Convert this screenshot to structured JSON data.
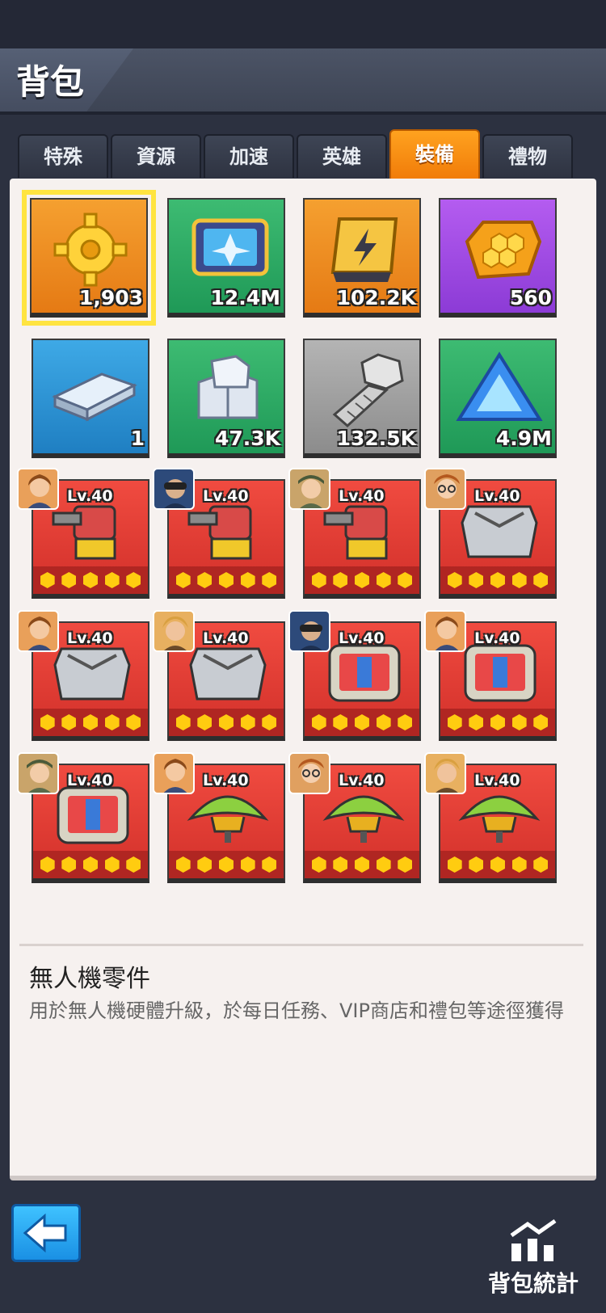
{
  "header": {
    "title": "背包"
  },
  "tabs": [
    {
      "label": "特殊",
      "active": false
    },
    {
      "label": "資源",
      "active": false
    },
    {
      "label": "加速",
      "active": false
    },
    {
      "label": "英雄",
      "active": false
    },
    {
      "label": "裝備",
      "active": true
    },
    {
      "label": "禮物",
      "active": false
    }
  ],
  "items": [
    {
      "icon": "gear-icon",
      "count": "1,903",
      "bg": "orange",
      "selected": true
    },
    {
      "icon": "drone-chip-icon",
      "count": "12.4M",
      "bg": "green"
    },
    {
      "icon": "energy-module-icon",
      "count": "102.2K",
      "bg": "orange"
    },
    {
      "icon": "honeycomb-armor-icon",
      "count": "560",
      "bg": "purple"
    },
    {
      "icon": "steel-ingot-icon",
      "count": "1",
      "bg": "blue"
    },
    {
      "icon": "alloy-blocks-icon",
      "count": "47.3K",
      "bg": "green"
    },
    {
      "icon": "bolt-icon",
      "count": "132.5K",
      "bg": "gray"
    },
    {
      "icon": "crystal-triangle-icon",
      "count": "4.9M",
      "bg": "green"
    }
  ],
  "equipment": [
    {
      "icon": "turret-icon",
      "level": "Lv.40",
      "hero": "hero-portrait-icon",
      "stars": 5
    },
    {
      "icon": "turret-icon",
      "level": "Lv.40",
      "hero": "hero-portrait-icon",
      "stars": 5
    },
    {
      "icon": "turret-icon",
      "level": "Lv.40",
      "hero": "hero-portrait-icon",
      "stars": 5
    },
    {
      "icon": "armor-plate-icon",
      "level": "Lv.40",
      "hero": "hero-portrait-icon",
      "stars": 5
    },
    {
      "icon": "armor-plate-icon",
      "level": "Lv.40",
      "hero": "hero-portrait-icon",
      "stars": 5
    },
    {
      "icon": "armor-plate-icon",
      "level": "Lv.40",
      "hero": "hero-portrait-icon",
      "stars": 5
    },
    {
      "icon": "radar-screen-icon",
      "level": "Lv.40",
      "hero": "hero-portrait-icon",
      "stars": 5
    },
    {
      "icon": "radar-screen-icon",
      "level": "Lv.40",
      "hero": "hero-portrait-icon",
      "stars": 5
    },
    {
      "icon": "radar-screen-icon",
      "level": "Lv.40",
      "hero": "hero-portrait-icon",
      "stars": 5
    },
    {
      "icon": "radar-dish-icon",
      "level": "Lv.40",
      "hero": "hero-portrait-icon",
      "stars": 5
    },
    {
      "icon": "radar-dish-icon",
      "level": "Lv.40",
      "hero": "hero-portrait-icon",
      "stars": 5
    },
    {
      "icon": "radar-dish-icon",
      "level": "Lv.40",
      "hero": "hero-portrait-icon",
      "stars": 5
    }
  ],
  "description": {
    "title": "無人機零件",
    "text": "用於無人機硬體升級，於每日任務、VIP商店和禮包等途徑獲得"
  },
  "footer": {
    "stats_label": "背包統計"
  },
  "colors": {
    "accent": "#f08a12",
    "panel": "#f6f1ef",
    "background": "#2c3140"
  }
}
